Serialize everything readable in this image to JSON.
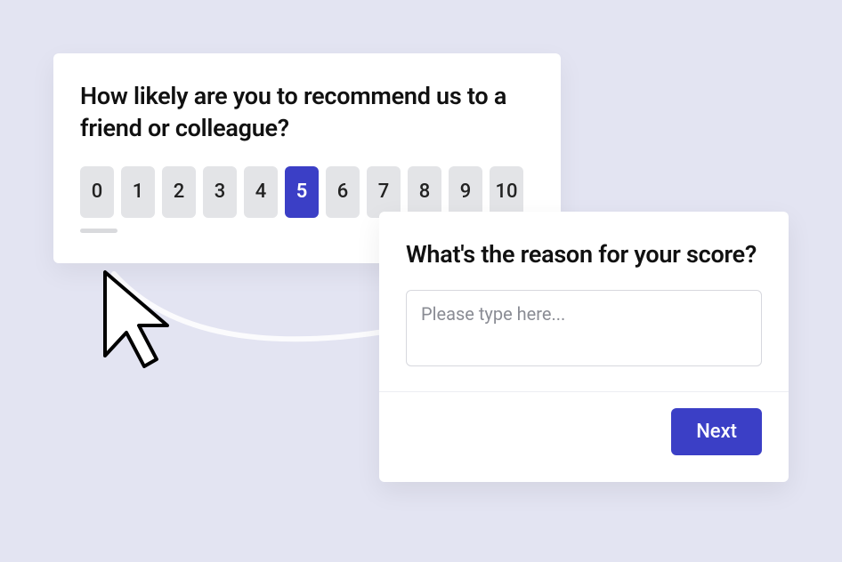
{
  "nps": {
    "question": "How likely are you to recommend us to a friend or colleague?",
    "options": [
      "0",
      "1",
      "2",
      "3",
      "4",
      "5",
      "6",
      "7",
      "8",
      "9",
      "10"
    ],
    "selected_value": "5"
  },
  "reason": {
    "question": "What's the reason for your score?",
    "placeholder": "Please type here...",
    "value": "",
    "next_label": "Next"
  },
  "colors": {
    "accent": "#3b3fc6",
    "card_bg": "#ffffff",
    "page_bg": "#e3e4f2",
    "neutral_button": "#e3e4e7"
  }
}
